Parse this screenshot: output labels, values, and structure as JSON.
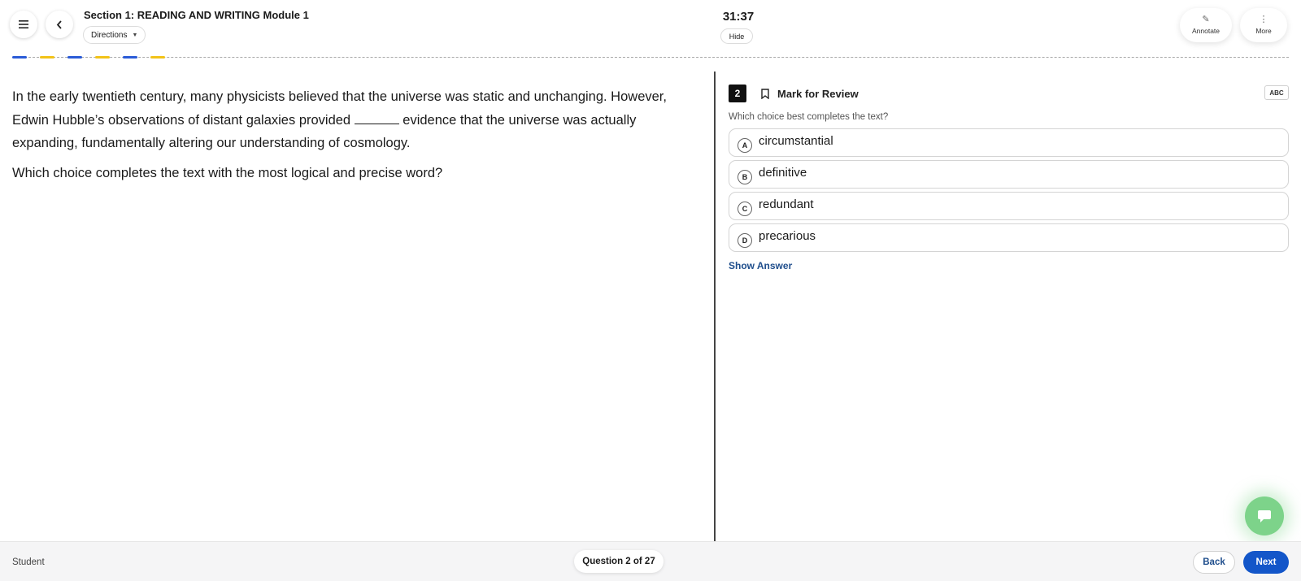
{
  "header": {
    "section_title": "Section 1: READING AND WRITING Module 1",
    "directions_label": "Directions",
    "timer": "31:37",
    "hide_label": "Hide",
    "annotate_label": "Annotate",
    "more_label": "More",
    "menu_icon": "hamburger-menu-icon",
    "back_icon": "chevron-left-icon"
  },
  "progress": {
    "segments": [
      {
        "state": "answered",
        "color": "#2a5bd7"
      },
      {
        "state": "flagged",
        "color": "#f2c318"
      },
      {
        "state": "answered",
        "color": "#2a5bd7"
      },
      {
        "state": "flagged",
        "color": "#f2c318"
      },
      {
        "state": "answered",
        "color": "#2a5bd7"
      },
      {
        "state": "flagged",
        "color": "#f2c318"
      }
    ]
  },
  "passage": {
    "text_before_blank": "In the early twentieth century, many physicists believed that the universe was static and unchanging. However, Edwin Hubble’s observations of distant galaxies provided ",
    "text_after_blank": " evidence that the universe was actually expanding, fundamentally altering our understanding of cosmology.",
    "prompt": "Which choice completes the text with the most logical and precise word?"
  },
  "question": {
    "number": "2",
    "mark_for_review_label": "Mark for Review",
    "abc_label": "ABC",
    "stem": "Which choice best completes the text?",
    "choices": [
      {
        "letter": "A",
        "text": "circumstantial"
      },
      {
        "letter": "B",
        "text": "definitive"
      },
      {
        "letter": "C",
        "text": "redundant"
      },
      {
        "letter": "D",
        "text": "precarious"
      }
    ],
    "show_answer_label": "Show Answer"
  },
  "footer": {
    "user_label": "Student",
    "question_counter": "Question 2 of 27",
    "back_label": "Back",
    "next_label": "Next"
  },
  "colors": {
    "primary": "#1356c9",
    "link": "#1f4e8c",
    "chat_fab": "#7dd38a"
  }
}
